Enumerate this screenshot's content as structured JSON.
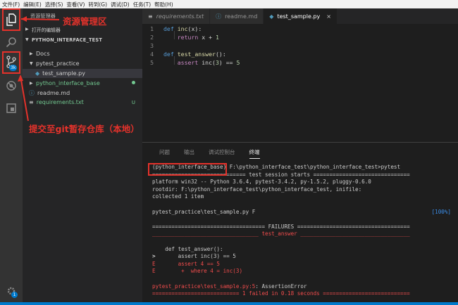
{
  "menubar": [
    "文件(F)",
    "编辑(E)",
    "选择(S)",
    "查看(V)",
    "转到(G)",
    "调试(D)",
    "任务(T)",
    "帮助(H)"
  ],
  "activitybar": {
    "explorer": "explorer-icon",
    "search": "search-icon",
    "scm": "source-control-icon",
    "scm_badge": "3k",
    "debug": "debug-icon",
    "extensions": "extensions-icon",
    "settings": "gear-icon",
    "settings_badge": "1"
  },
  "sidebar": {
    "title": "资源管理器",
    "open_editors": "打开的编辑器",
    "project": "PYTHON_INTERFACE_TEST",
    "items": [
      {
        "label": "Docs",
        "kind": "folder-collapsed",
        "status": ""
      },
      {
        "label": "pytest_practice",
        "kind": "folder-expanded",
        "status": ""
      },
      {
        "label": "test_sample.py",
        "kind": "python-file",
        "status": ""
      },
      {
        "label": "python_interface_base",
        "kind": "folder-collapsed",
        "status": "dot"
      },
      {
        "label": "readme.md",
        "kind": "info-file",
        "status": ""
      },
      {
        "label": "requirements.txt",
        "kind": "text-file",
        "status": "U"
      }
    ]
  },
  "tabs": [
    {
      "label": "requirements.txt",
      "icon": "text-file-icon",
      "active": false
    },
    {
      "label": "readme.md",
      "icon": "info-icon",
      "active": false
    },
    {
      "label": "test_sample.py",
      "icon": "python-file-icon",
      "active": true,
      "close": "×"
    }
  ],
  "editor": {
    "line_numbers": [
      "1",
      "2",
      "3",
      "4",
      "5"
    ],
    "lines": [
      [
        "def",
        " ",
        "inc",
        "(x):"
      ],
      [
        "    ",
        "return",
        " x + ",
        "1"
      ],
      [],
      [
        "def",
        " ",
        "test_answer",
        "():"
      ],
      [
        "    ",
        "assert",
        " inc(",
        "3",
        ") == ",
        "5"
      ]
    ]
  },
  "panel": {
    "tabs": [
      "问题",
      "输出",
      "调试控制台",
      "终端"
    ],
    "active_tab": "终端",
    "terminal": {
      "prompt_env": "(python_interface_base)",
      "prompt_path": " F:\\python_interface_test\\python_interface_test>pytest",
      "l2": "============================= test session starts ==============================",
      "l3": "platform win32 -- Python 3.6.4, pytest-3.4.2, py-1.5.2, pluggy-0.6.0",
      "l4": "rootdir: F:\\python_interface_test\\python_interface_test, inifile:",
      "l5": "collected 1 item",
      "l6": "pytest_practice\\test_sample.py F",
      "l6_progress": "[100%]",
      "l7": "=================================== FAILURES ===================================",
      "l8": "_________________________________ test_answer __________________________________",
      "l9": "    def test_answer():",
      "l10a": ">       ",
      "l10b": "assert inc(3) == 5",
      "l11": "E       assert 4 == 5",
      "l12": "E        +  where 4 = inc(3)",
      "l13a": "pytest_practice\\test_sample.py:5",
      "l13b": ": AssertionError",
      "l14": "=========================== 1 failed in 0.18 seconds ==========================="
    }
  },
  "annotations": {
    "explorer": "资源管理区",
    "scm": "提交至git暂存仓库（本地）"
  },
  "colors": {
    "annotation": "#e5322b",
    "statusbar": "#007acc",
    "badge": "#007acc"
  }
}
